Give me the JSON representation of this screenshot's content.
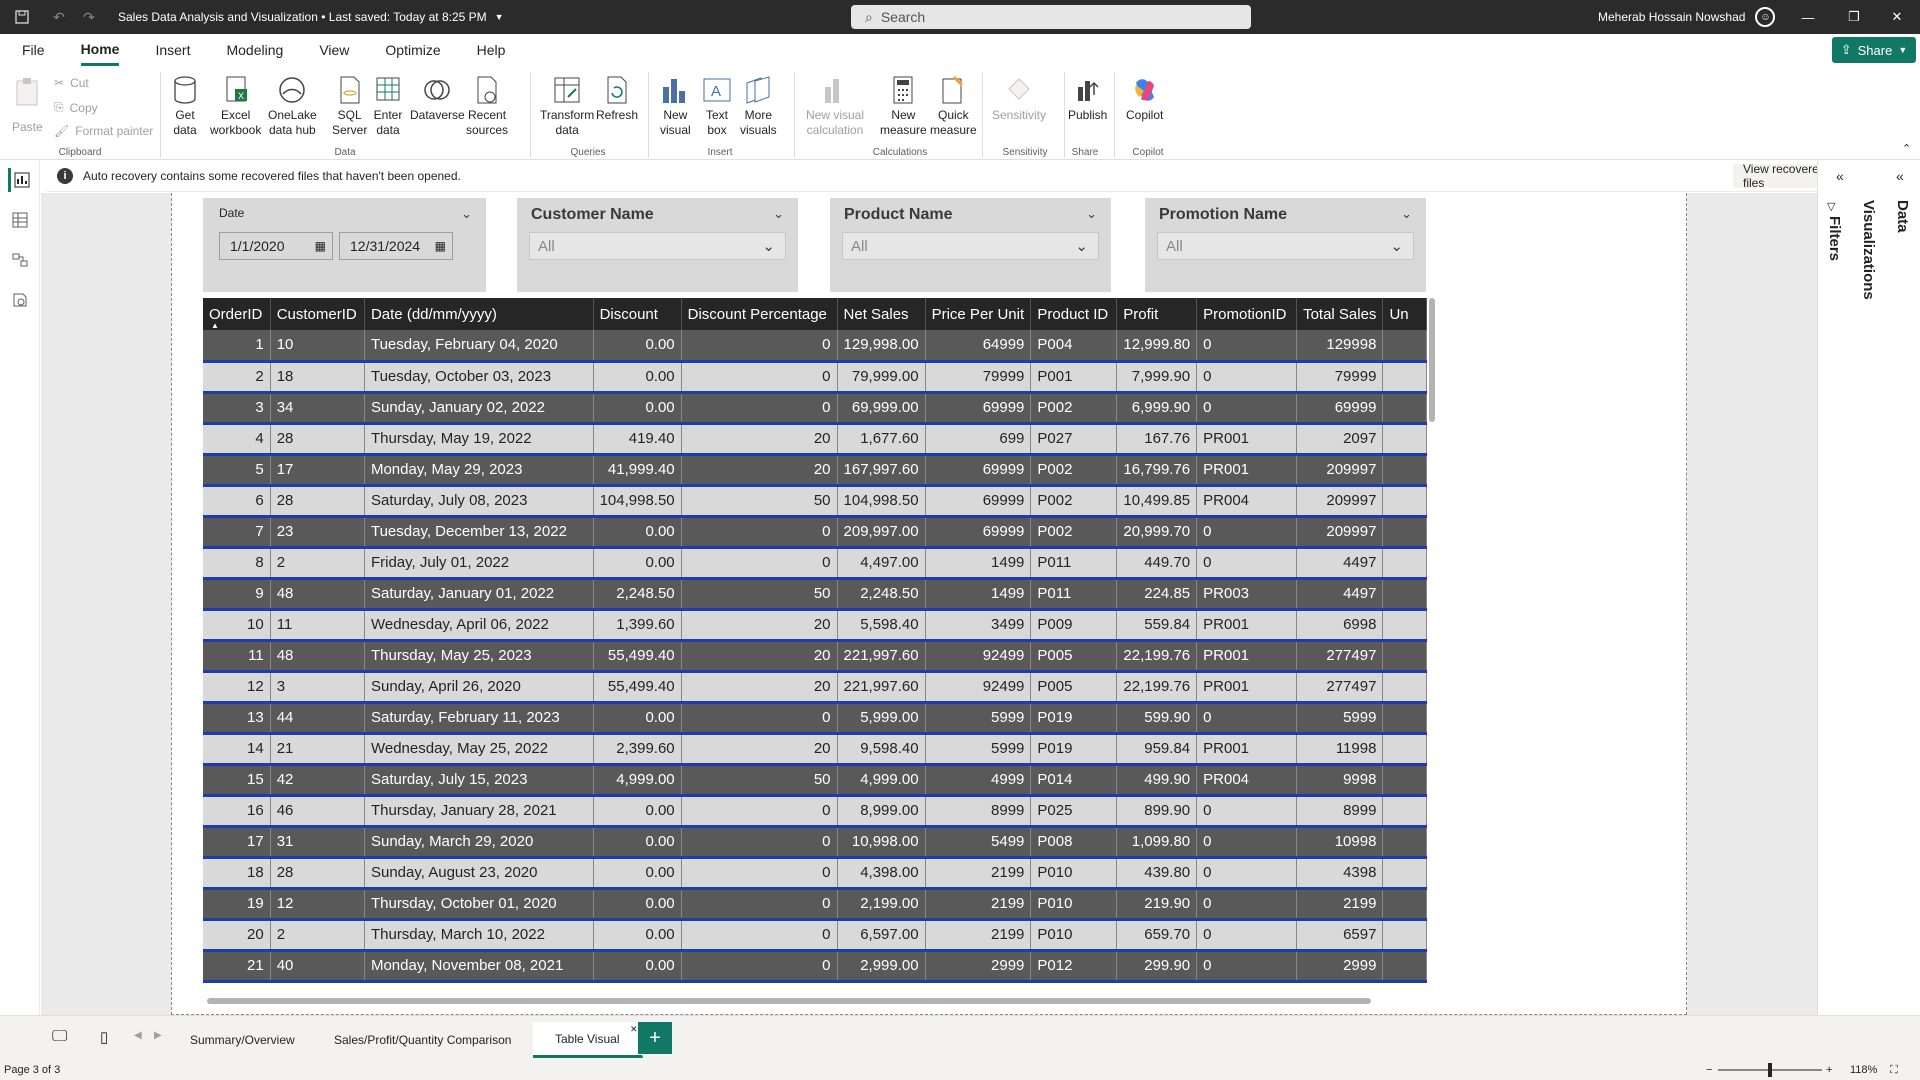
{
  "titlebar": {
    "title": "Sales Data Analysis and Visualization • Last saved: Today at 8:25 PM",
    "search_placeholder": "Search",
    "user": "Meherab Hossain Nowshad"
  },
  "menu": [
    "File",
    "Home",
    "Insert",
    "Modeling",
    "View",
    "Optimize",
    "Help"
  ],
  "share_label": "Share",
  "ribbon": {
    "paste": "Paste",
    "cut": "Cut",
    "copy": "Copy",
    "format_painter": "Format painter",
    "get_data": "Get\ndata",
    "excel": "Excel\nworkbook",
    "onelake": "OneLake\ndata hub",
    "sql": "SQL\nServer",
    "enter_data": "Enter\ndata",
    "dataverse": "Dataverse",
    "recent": "Recent\nsources",
    "transform": "Transform\ndata",
    "refresh": "Refresh",
    "new_visual": "New\nvisual",
    "text_box": "Text\nbox",
    "more_visuals": "More\nvisuals",
    "new_visual_calc": "New visual\ncalculation",
    "new_measure": "New\nmeasure",
    "quick_measure": "Quick\nmeasure",
    "sensitivity": "Sensitivity",
    "publish": "Publish",
    "copilot": "Copilot",
    "groups": {
      "clipboard": "Clipboard",
      "data": "Data",
      "queries": "Queries",
      "insert": "Insert",
      "calculations": "Calculations",
      "sensitivity": "Sensitivity",
      "share": "Share",
      "copilot": "Copilot"
    }
  },
  "notice": {
    "text": "Auto recovery contains some recovered files that haven't been opened.",
    "button": "View recovered files"
  },
  "panes": {
    "filters": "Filters",
    "visualizations": "Visualizations",
    "data": "Data"
  },
  "slicers": {
    "date": {
      "title": "Date",
      "from": "1/1/2020",
      "to": "12/31/2024"
    },
    "customer": {
      "title": "Customer Name",
      "value": "All"
    },
    "product": {
      "title": "Product Name",
      "value": "All"
    },
    "promotion": {
      "title": "Promotion Name",
      "value": "All"
    }
  },
  "table": {
    "columns": [
      "OrderID",
      "CustomerID",
      "Date (dd/mm/yyyy)",
      "Discount",
      "Discount Percentage",
      "Net Sales",
      "Price Per Unit",
      "Product ID",
      "Profit",
      "PromotionID",
      "Total Sales",
      "Un"
    ],
    "rows": [
      [
        "1",
        "10",
        "Tuesday, February 04, 2020",
        "0.00",
        "0",
        "129,998.00",
        "64999",
        "P004",
        "12,999.80",
        "0",
        "129998"
      ],
      [
        "2",
        "18",
        "Tuesday, October 03, 2023",
        "0.00",
        "0",
        "79,999.00",
        "79999",
        "P001",
        "7,999.90",
        "0",
        "79999"
      ],
      [
        "3",
        "34",
        "Sunday, January 02, 2022",
        "0.00",
        "0",
        "69,999.00",
        "69999",
        "P002",
        "6,999.90",
        "0",
        "69999"
      ],
      [
        "4",
        "28",
        "Thursday, May 19, 2022",
        "419.40",
        "20",
        "1,677.60",
        "699",
        "P027",
        "167.76",
        "PR001",
        "2097"
      ],
      [
        "5",
        "17",
        "Monday, May 29, 2023",
        "41,999.40",
        "20",
        "167,997.60",
        "69999",
        "P002",
        "16,799.76",
        "PR001",
        "209997"
      ],
      [
        "6",
        "28",
        "Saturday, July 08, 2023",
        "104,998.50",
        "50",
        "104,998.50",
        "69999",
        "P002",
        "10,499.85",
        "PR004",
        "209997"
      ],
      [
        "7",
        "23",
        "Tuesday, December 13, 2022",
        "0.00",
        "0",
        "209,997.00",
        "69999",
        "P002",
        "20,999.70",
        "0",
        "209997"
      ],
      [
        "8",
        "2",
        "Friday, July 01, 2022",
        "0.00",
        "0",
        "4,497.00",
        "1499",
        "P011",
        "449.70",
        "0",
        "4497"
      ],
      [
        "9",
        "48",
        "Saturday, January 01, 2022",
        "2,248.50",
        "50",
        "2,248.50",
        "1499",
        "P011",
        "224.85",
        "PR003",
        "4497"
      ],
      [
        "10",
        "11",
        "Wednesday, April 06, 2022",
        "1,399.60",
        "20",
        "5,598.40",
        "3499",
        "P009",
        "559.84",
        "PR001",
        "6998"
      ],
      [
        "11",
        "48",
        "Thursday, May 25, 2023",
        "55,499.40",
        "20",
        "221,997.60",
        "92499",
        "P005",
        "22,199.76",
        "PR001",
        "277497"
      ],
      [
        "12",
        "3",
        "Sunday, April 26, 2020",
        "55,499.40",
        "20",
        "221,997.60",
        "92499",
        "P005",
        "22,199.76",
        "PR001",
        "277497"
      ],
      [
        "13",
        "44",
        "Saturday, February 11, 2023",
        "0.00",
        "0",
        "5,999.00",
        "5999",
        "P019",
        "599.90",
        "0",
        "5999"
      ],
      [
        "14",
        "21",
        "Wednesday, May 25, 2022",
        "2,399.60",
        "20",
        "9,598.40",
        "5999",
        "P019",
        "959.84",
        "PR001",
        "11998"
      ],
      [
        "15",
        "42",
        "Saturday, July 15, 2023",
        "4,999.00",
        "50",
        "4,999.00",
        "4999",
        "P014",
        "499.90",
        "PR004",
        "9998"
      ],
      [
        "16",
        "46",
        "Thursday, January 28, 2021",
        "0.00",
        "0",
        "8,999.00",
        "8999",
        "P025",
        "899.90",
        "0",
        "8999"
      ],
      [
        "17",
        "31",
        "Sunday, March 29, 2020",
        "0.00",
        "0",
        "10,998.00",
        "5499",
        "P008",
        "1,099.80",
        "0",
        "10998"
      ],
      [
        "18",
        "28",
        "Sunday, August 23, 2020",
        "0.00",
        "0",
        "4,398.00",
        "2199",
        "P010",
        "439.80",
        "0",
        "4398"
      ],
      [
        "19",
        "12",
        "Thursday, October 01, 2020",
        "0.00",
        "0",
        "2,199.00",
        "2199",
        "P010",
        "219.90",
        "0",
        "2199"
      ],
      [
        "20",
        "2",
        "Thursday, March 10, 2022",
        "0.00",
        "0",
        "6,597.00",
        "2199",
        "P010",
        "659.70",
        "0",
        "6597"
      ],
      [
        "21",
        "40",
        "Monday, November 08, 2021",
        "0.00",
        "0",
        "2,999.00",
        "2999",
        "P012",
        "299.90",
        "0",
        "2999"
      ]
    ]
  },
  "page_tabs": [
    "Summary/Overview",
    "Sales/Profit/Quantity Comparison",
    "Table Visual"
  ],
  "status": {
    "page": "Page 3 of 3",
    "zoom": "118%"
  }
}
